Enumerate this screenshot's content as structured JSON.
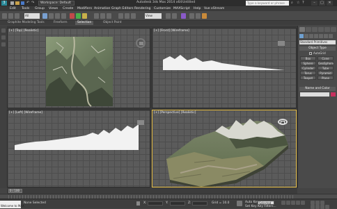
{
  "titlebar": {
    "workspace": "Workspace: Default",
    "title": "Autodesk 3ds Max 2014 x64",
    "document": "Untitled",
    "search_placeholder": "Type a keyword or phrase",
    "min": "–",
    "max": "□",
    "close": "✕"
  },
  "menu": [
    "Edit",
    "Tools",
    "Group",
    "Views",
    "Create",
    "Modifiers",
    "Animation",
    "Graph Editors",
    "Rendering",
    "Customize",
    "MAXScript",
    "Help",
    "Vue xStream"
  ],
  "toolbar": {
    "selection_filter": "All",
    "ref_coord": "View"
  },
  "ribbon": {
    "tabs": [
      "Graphite Modeling Tools",
      "Freeform",
      "Selection",
      "Object Paint"
    ],
    "active": 2
  },
  "viewports": {
    "top": {
      "label": "[+] [Top] [Realistic]"
    },
    "front": {
      "label": "[+] [Front] [Wireframe]"
    },
    "left": {
      "label": "[+] [Left] [Wireframe]"
    },
    "perspective": {
      "label": "[+] [Perspective] [Realistic]"
    }
  },
  "command_panel": {
    "dropdown": "Standard Primitives",
    "object_type_title": "Object Type",
    "autogrid": "AutoGrid",
    "buttons": [
      "Box",
      "Cone",
      "Sphere",
      "GeoSphere",
      "Cylinder",
      "Tube",
      "Torus",
      "Pyramid",
      "Teapot",
      "Plane"
    ],
    "name_color_title": "Name and Color"
  },
  "timeline": {
    "frame": "0 / 100"
  },
  "status": {
    "welcome": "Welcome to MAX",
    "selected": "None Selected",
    "x_label": "X:",
    "y_label": "Y:",
    "z_label": "Z:",
    "grid": "Grid = 10.0",
    "autokey": "Auto Key",
    "setkey": "Set Key",
    "selected_dd": "Selected",
    "keyfilters": "Key Filters..."
  },
  "colors": {
    "active_border": "#e8c048",
    "accent_swatch": "#c8305e"
  }
}
